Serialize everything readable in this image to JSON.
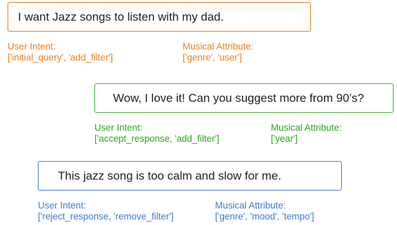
{
  "colors": {
    "orange": "#f07f1e",
    "green": "#3db534",
    "blue": "#4a7ddb"
  },
  "exchanges": [
    {
      "utterance": "I want Jazz songs to listen with my dad.",
      "intent_label": "User Intent:",
      "intent_values": "['initial_query', 'add_filter']",
      "attribute_label": "Musical Attribute:",
      "attribute_values": "['genre', 'user']"
    },
    {
      "utterance": "Wow, I love it! Can you suggest more from 90’s?",
      "intent_label": "User Intent:",
      "intent_values": "['accept_response, 'add_filter']",
      "attribute_label": "Musical Attribute:",
      "attribute_values": "['year']"
    },
    {
      "utterance": "This jazz song is too calm and slow for me.",
      "intent_label": "User Intent:",
      "intent_values": "['reject_response, 'remove_filter']",
      "attribute_label": "Musical Attribute:",
      "attribute_values": "['genre', 'mood', 'tempo']"
    }
  ]
}
